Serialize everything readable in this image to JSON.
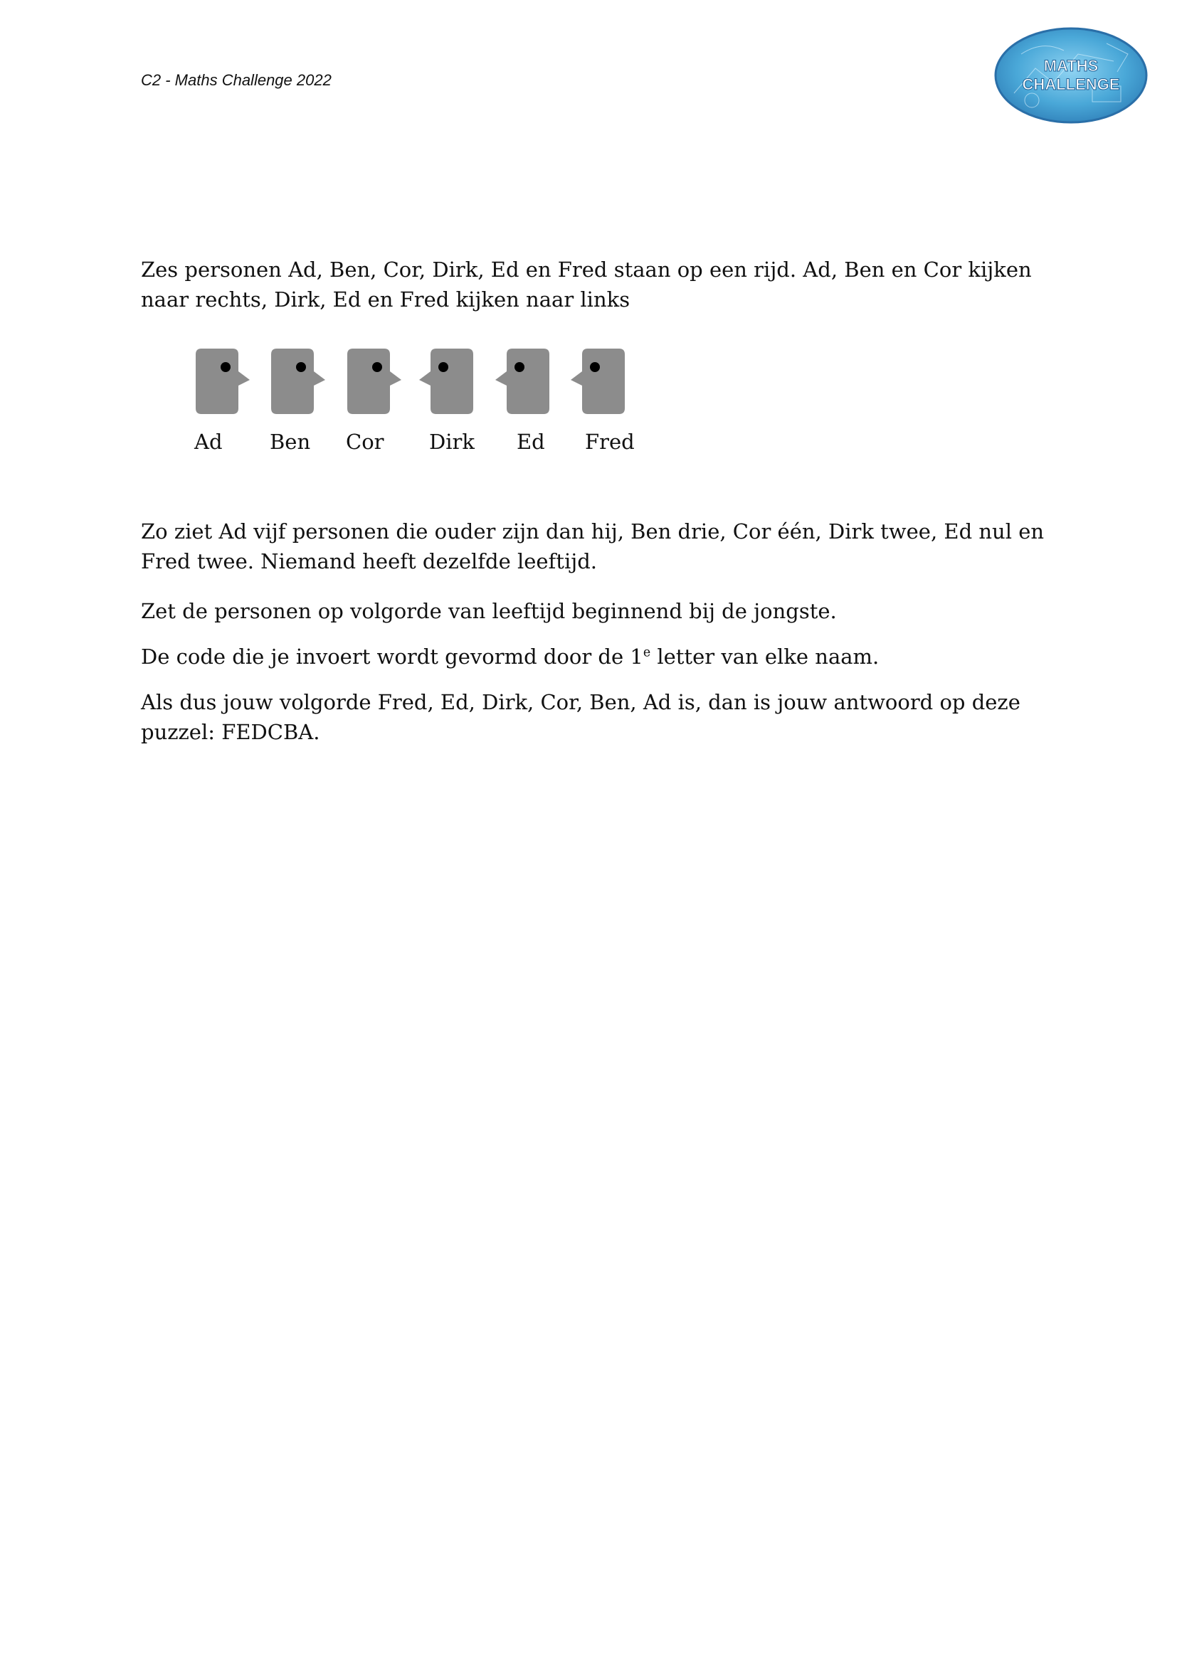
{
  "header": {
    "title": "C2 - Maths Challenge 2022",
    "logo_text_line1": "MATHS",
    "logo_text_line2": "CHALLENGE"
  },
  "intro": "Zes personen Ad, Ben, Cor, Dirk, Ed en Fred staan op een rijd. Ad, Ben en Cor kijken naar rechts, Dirk, Ed en Fred kijken naar links",
  "figure": {
    "people": [
      {
        "name": "Ad",
        "facing": "right"
      },
      {
        "name": "Ben",
        "facing": "right"
      },
      {
        "name": "Cor",
        "facing": "right"
      },
      {
        "name": "Dirk",
        "facing": "left"
      },
      {
        "name": "Ed",
        "facing": "left"
      },
      {
        "name": "Fred",
        "facing": "left"
      }
    ]
  },
  "body": {
    "p1": "Zo ziet Ad vijf personen die ouder zijn dan hij, Ben drie, Cor één, Dirk twee, Ed nul en Fred twee. Niemand heeft dezelfde leeftijd.",
    "p2": "Zet de personen op volgorde van leeftijd beginnend bij de jongste.",
    "p3_before": "De code die je invoert wordt gevormd door de 1",
    "p3_sup": "e",
    "p3_after": " letter van elke naam.",
    "p4": "Als dus jouw volgorde Fred, Ed, Dirk, Cor, Ben, Ad is, dan is jouw antwoord op deze puzzel: FEDCBA."
  },
  "colors": {
    "head_fill": "#8c8c8c",
    "eye": "#000000",
    "logo_bg": "#4aa8d8",
    "logo_border": "#2a6fa8"
  }
}
